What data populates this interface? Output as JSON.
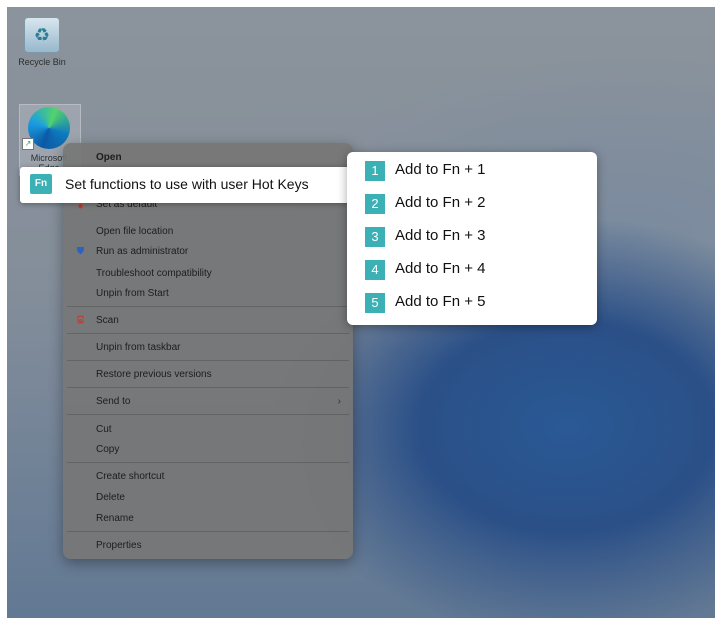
{
  "desktop": {
    "icons": [
      {
        "label": "Recycle Bin",
        "icon": "recycle-bin-icon"
      },
      {
        "label": "Microsoft Edge",
        "icon": "edge-icon"
      }
    ]
  },
  "context_menu": {
    "items": [
      {
        "label": "Open",
        "bold": true
      },
      {
        "label": "Set as default"
      },
      {
        "label": "Open file location"
      },
      {
        "label": "Run as administrator",
        "icon": "shield-icon"
      },
      {
        "label": "Troubleshoot compatibility"
      },
      {
        "label": "Unpin from Start"
      },
      {
        "label": "Scan",
        "icon": "scan-icon"
      },
      {
        "label": "Unpin from taskbar"
      },
      {
        "label": "Restore previous versions"
      },
      {
        "label": "Send to",
        "has_submenu": true
      },
      {
        "label": "Cut"
      },
      {
        "label": "Copy"
      },
      {
        "label": "Create shortcut"
      },
      {
        "label": "Delete"
      },
      {
        "label": "Rename"
      },
      {
        "label": "Properties"
      }
    ]
  },
  "hotkey_item": {
    "badge": "Fn",
    "label": "Set functions to use with user Hot Keys"
  },
  "submenu": {
    "items": [
      {
        "num": "1",
        "label": "Add to Fn + 1"
      },
      {
        "num": "2",
        "label": "Add to Fn + 2"
      },
      {
        "num": "3",
        "label": "Add to Fn + 3"
      },
      {
        "num": "4",
        "label": "Add to Fn + 4"
      },
      {
        "num": "5",
        "label": "Add to Fn + 5"
      }
    ]
  },
  "colors": {
    "accent_teal": "#3bb0b5",
    "menu_dim": "#767676"
  }
}
